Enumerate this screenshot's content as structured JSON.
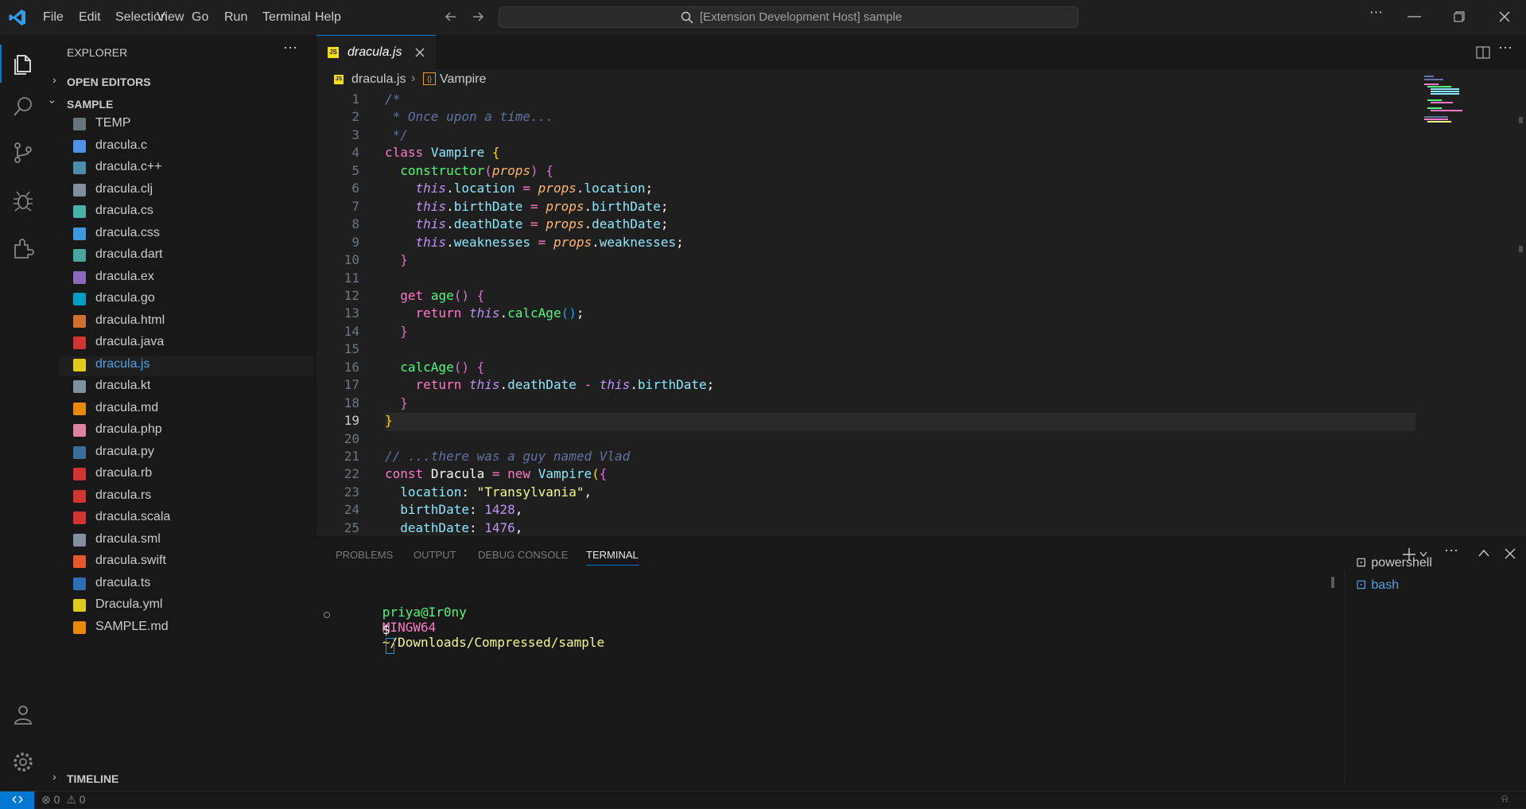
{
  "titlebar": {
    "menu": [
      "File",
      "Edit",
      "Selection",
      "View",
      "Go",
      "Run",
      "Terminal",
      "Help"
    ],
    "search_text": "[Extension Development Host] sample"
  },
  "sidebar": {
    "title": "EXPLORER",
    "open_editors": "OPEN EDITORS",
    "folder": "SAMPLE",
    "timeline": "TIMELINE",
    "files": [
      {
        "name": "TEMP",
        "icon": "folder-icon",
        "color": "#6d8086"
      },
      {
        "name": "dracula.c",
        "icon": "c-icon",
        "color": "#599eff"
      },
      {
        "name": "dracula.c++",
        "icon": "cpp-icon",
        "color": "#519aba"
      },
      {
        "name": "dracula.clj",
        "icon": "file-icon",
        "color": "#8e9cae"
      },
      {
        "name": "dracula.cs",
        "icon": "csharp-icon",
        "color": "#4bc5b5"
      },
      {
        "name": "dracula.css",
        "icon": "css-icon",
        "color": "#42a5f5"
      },
      {
        "name": "dracula.dart",
        "icon": "dart-icon",
        "color": "#4db6ac"
      },
      {
        "name": "dracula.ex",
        "icon": "elixir-icon",
        "color": "#9575cd"
      },
      {
        "name": "dracula.go",
        "icon": "go-icon",
        "color": "#00add8"
      },
      {
        "name": "dracula.html",
        "icon": "html-icon",
        "color": "#e37933"
      },
      {
        "name": "dracula.java",
        "icon": "java-icon",
        "color": "#e53935"
      },
      {
        "name": "dracula.js",
        "icon": "js-icon",
        "color": "#f5de19",
        "active": true
      },
      {
        "name": "dracula.kt",
        "icon": "file-icon",
        "color": "#8e9cae"
      },
      {
        "name": "dracula.md",
        "icon": "markdown-icon",
        "color": "#ff9800"
      },
      {
        "name": "dracula.php",
        "icon": "php-icon",
        "color": "#f48fb1"
      },
      {
        "name": "dracula.py",
        "icon": "python-icon",
        "color": "#3c78aa"
      },
      {
        "name": "dracula.rb",
        "icon": "ruby-icon",
        "color": "#e53935"
      },
      {
        "name": "dracula.rs",
        "icon": "rust-icon",
        "color": "#e53935"
      },
      {
        "name": "dracula.scala",
        "icon": "scala-icon",
        "color": "#e53935"
      },
      {
        "name": "dracula.sml",
        "icon": "file-icon",
        "color": "#8e9cae"
      },
      {
        "name": "dracula.swift",
        "icon": "swift-icon",
        "color": "#fe5e2f"
      },
      {
        "name": "dracula.ts",
        "icon": "typescript-icon",
        "color": "#3178c6"
      },
      {
        "name": "Dracula.yml",
        "icon": "yaml-icon",
        "color": "#f5de19"
      },
      {
        "name": "SAMPLE.md",
        "icon": "markdown-icon",
        "color": "#ff9800"
      }
    ]
  },
  "editor": {
    "tab_label": "dracula.js",
    "breadcrumb": [
      "dracula.js",
      "Vampire"
    ],
    "current_line": 19,
    "lines": [
      [
        [
          "/*",
          "c-cm"
        ]
      ],
      [
        [
          " * Once upon a time...",
          "c-cm"
        ]
      ],
      [
        [
          " */",
          "c-cm"
        ]
      ],
      [
        [
          "class",
          "c-kw"
        ],
        [
          " ",
          ""
        ],
        [
          "Vampire",
          "c-cls"
        ],
        [
          " ",
          ""
        ],
        [
          "{",
          "c-br1"
        ]
      ],
      [
        [
          "  ",
          ""
        ],
        [
          "constructor",
          "c-fn"
        ],
        [
          "(",
          "c-br2"
        ],
        [
          "props",
          "c-pa"
        ],
        [
          ")",
          "c-br2"
        ],
        [
          " ",
          ""
        ],
        [
          "{",
          "c-br2"
        ]
      ],
      [
        [
          "    ",
          ""
        ],
        [
          "this",
          "c-this"
        ],
        [
          ".",
          ""
        ],
        [
          "location",
          "c-pr"
        ],
        [
          " = ",
          "c-kw"
        ],
        [
          "props",
          "c-pa"
        ],
        [
          ".",
          ""
        ],
        [
          "location",
          "c-pr"
        ],
        [
          ";",
          ""
        ]
      ],
      [
        [
          "    ",
          ""
        ],
        [
          "this",
          "c-this"
        ],
        [
          ".",
          ""
        ],
        [
          "birthDate",
          "c-pr"
        ],
        [
          " = ",
          "c-kw"
        ],
        [
          "props",
          "c-pa"
        ],
        [
          ".",
          ""
        ],
        [
          "birthDate",
          "c-pr"
        ],
        [
          ";",
          ""
        ]
      ],
      [
        [
          "    ",
          ""
        ],
        [
          "this",
          "c-this"
        ],
        [
          ".",
          ""
        ],
        [
          "deathDate",
          "c-pr"
        ],
        [
          " = ",
          "c-kw"
        ],
        [
          "props",
          "c-pa"
        ],
        [
          ".",
          ""
        ],
        [
          "deathDate",
          "c-pr"
        ],
        [
          ";",
          ""
        ]
      ],
      [
        [
          "    ",
          ""
        ],
        [
          "this",
          "c-this"
        ],
        [
          ".",
          ""
        ],
        [
          "weaknesses",
          "c-pr"
        ],
        [
          " = ",
          "c-kw"
        ],
        [
          "props",
          "c-pa"
        ],
        [
          ".",
          ""
        ],
        [
          "weaknesses",
          "c-pr"
        ],
        [
          ";",
          ""
        ]
      ],
      [
        [
          "  ",
          ""
        ],
        [
          "}",
          "c-br2"
        ]
      ],
      [],
      [
        [
          "  ",
          ""
        ],
        [
          "get",
          "c-kw"
        ],
        [
          " ",
          ""
        ],
        [
          "age",
          "c-fn"
        ],
        [
          "()",
          "c-br2"
        ],
        [
          " ",
          ""
        ],
        [
          "{",
          "c-br2"
        ]
      ],
      [
        [
          "    ",
          ""
        ],
        [
          "return",
          "c-kw"
        ],
        [
          " ",
          ""
        ],
        [
          "this",
          "c-this"
        ],
        [
          ".",
          ""
        ],
        [
          "calcAge",
          "c-fn"
        ],
        [
          "()",
          "c-br3"
        ],
        [
          ";",
          ""
        ]
      ],
      [
        [
          "  ",
          ""
        ],
        [
          "}",
          "c-br2"
        ]
      ],
      [],
      [
        [
          "  ",
          ""
        ],
        [
          "calcAge",
          "c-fn"
        ],
        [
          "()",
          "c-br2"
        ],
        [
          " ",
          ""
        ],
        [
          "{",
          "c-br2"
        ]
      ],
      [
        [
          "    ",
          ""
        ],
        [
          "return",
          "c-kw"
        ],
        [
          " ",
          ""
        ],
        [
          "this",
          "c-this"
        ],
        [
          ".",
          ""
        ],
        [
          "deathDate",
          "c-pr"
        ],
        [
          " - ",
          "c-kw"
        ],
        [
          "this",
          "c-this"
        ],
        [
          ".",
          ""
        ],
        [
          "birthDate",
          "c-pr"
        ],
        [
          ";",
          ""
        ]
      ],
      [
        [
          "  ",
          ""
        ],
        [
          "}",
          "c-br2"
        ]
      ],
      [
        [
          "}",
          "c-br1"
        ]
      ],
      [],
      [
        [
          "// ...there was a guy named Vlad",
          "c-cm"
        ]
      ],
      [
        [
          "const",
          "c-kw"
        ],
        [
          " ",
          ""
        ],
        [
          "Dracula",
          ""
        ],
        [
          " = ",
          "c-kw"
        ],
        [
          "new",
          "c-kw"
        ],
        [
          " ",
          ""
        ],
        [
          "Vampire",
          "c-cls"
        ],
        [
          "(",
          "c-br1"
        ],
        [
          "{",
          "c-br2"
        ]
      ],
      [
        [
          "  ",
          ""
        ],
        [
          "location",
          "c-pr"
        ],
        [
          ": ",
          ""
        ],
        [
          "\"Transylvania\"",
          "c-st"
        ],
        [
          ",",
          ""
        ]
      ],
      [
        [
          "  ",
          ""
        ],
        [
          "birthDate",
          "c-pr"
        ],
        [
          ": ",
          ""
        ],
        [
          "1428",
          "c-nu"
        ],
        [
          ",",
          ""
        ]
      ],
      [
        [
          "  ",
          ""
        ],
        [
          "deathDate",
          "c-pr"
        ],
        [
          ": ",
          ""
        ],
        [
          "1476",
          "c-nu"
        ],
        [
          ",",
          ""
        ]
      ]
    ]
  },
  "panel": {
    "tabs": [
      "PROBLEMS",
      "OUTPUT",
      "DEBUG CONSOLE",
      "TERMINAL"
    ],
    "active_tab": "TERMINAL",
    "terminal": {
      "user": "priya@Ir0ny",
      "system": "MINGW64",
      "path": "~/Downloads/Compressed/sample",
      "prompt": "$"
    },
    "terminals": [
      "powershell",
      "bash"
    ]
  },
  "statusbar": {
    "errors": "0",
    "warnings": "0"
  },
  "colors": {
    "accent": "#0078d4",
    "background": "#1f1f1f",
    "sidebar": "#181818"
  }
}
